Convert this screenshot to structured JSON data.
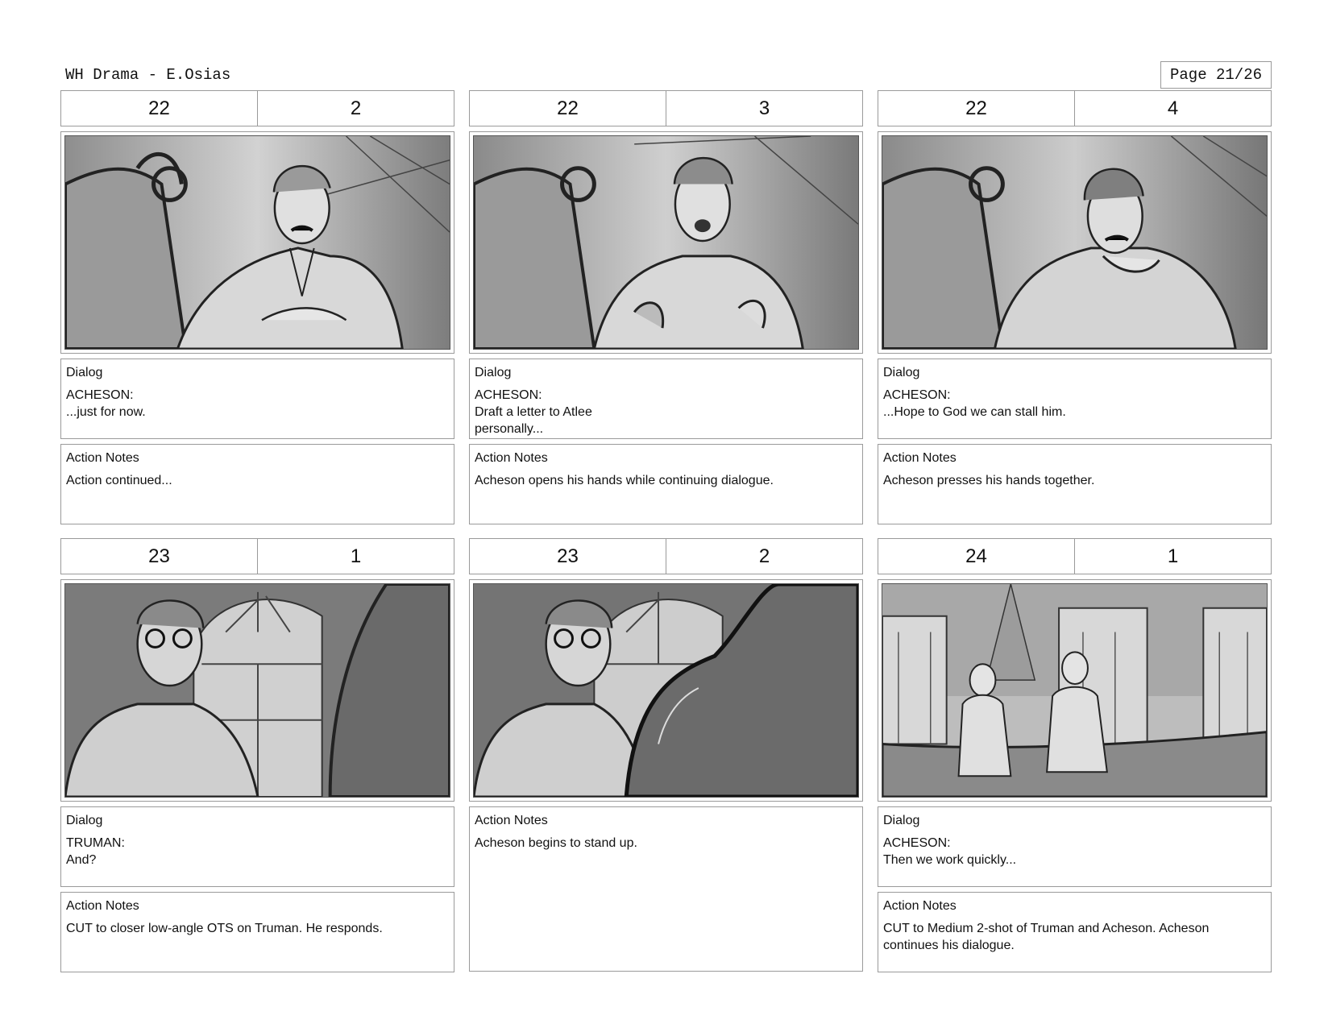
{
  "header": {
    "title": "WH Drama - E.Osias",
    "page": "Page 21/26"
  },
  "labels": {
    "dialog": "Dialog",
    "action_notes": "Action Notes"
  },
  "panels": [
    {
      "scene": "22",
      "shot": "2",
      "dialog": "ACHESON:\n...just for now.",
      "action": "Action continued..."
    },
    {
      "scene": "22",
      "shot": "3",
      "dialog": "ACHESON:\nDraft a letter to Atlee\npersonally...",
      "action": "Acheson opens his hands while continuing dialogue."
    },
    {
      "scene": "22",
      "shot": "4",
      "dialog": "ACHESON:\n...Hope to God we can stall him.",
      "action": "Acheson presses his hands together."
    },
    {
      "scene": "23",
      "shot": "1",
      "dialog": "TRUMAN:\nAnd?",
      "action": "CUT to closer low-angle OTS on Truman. He responds."
    },
    {
      "scene": "23",
      "shot": "2",
      "action": "Acheson begins to stand up."
    },
    {
      "scene": "24",
      "shot": "1",
      "dialog": "ACHESON:\nThen we work quickly...",
      "action": "CUT to Medium 2-shot of Truman and Acheson. Acheson continues his dialogue."
    }
  ]
}
